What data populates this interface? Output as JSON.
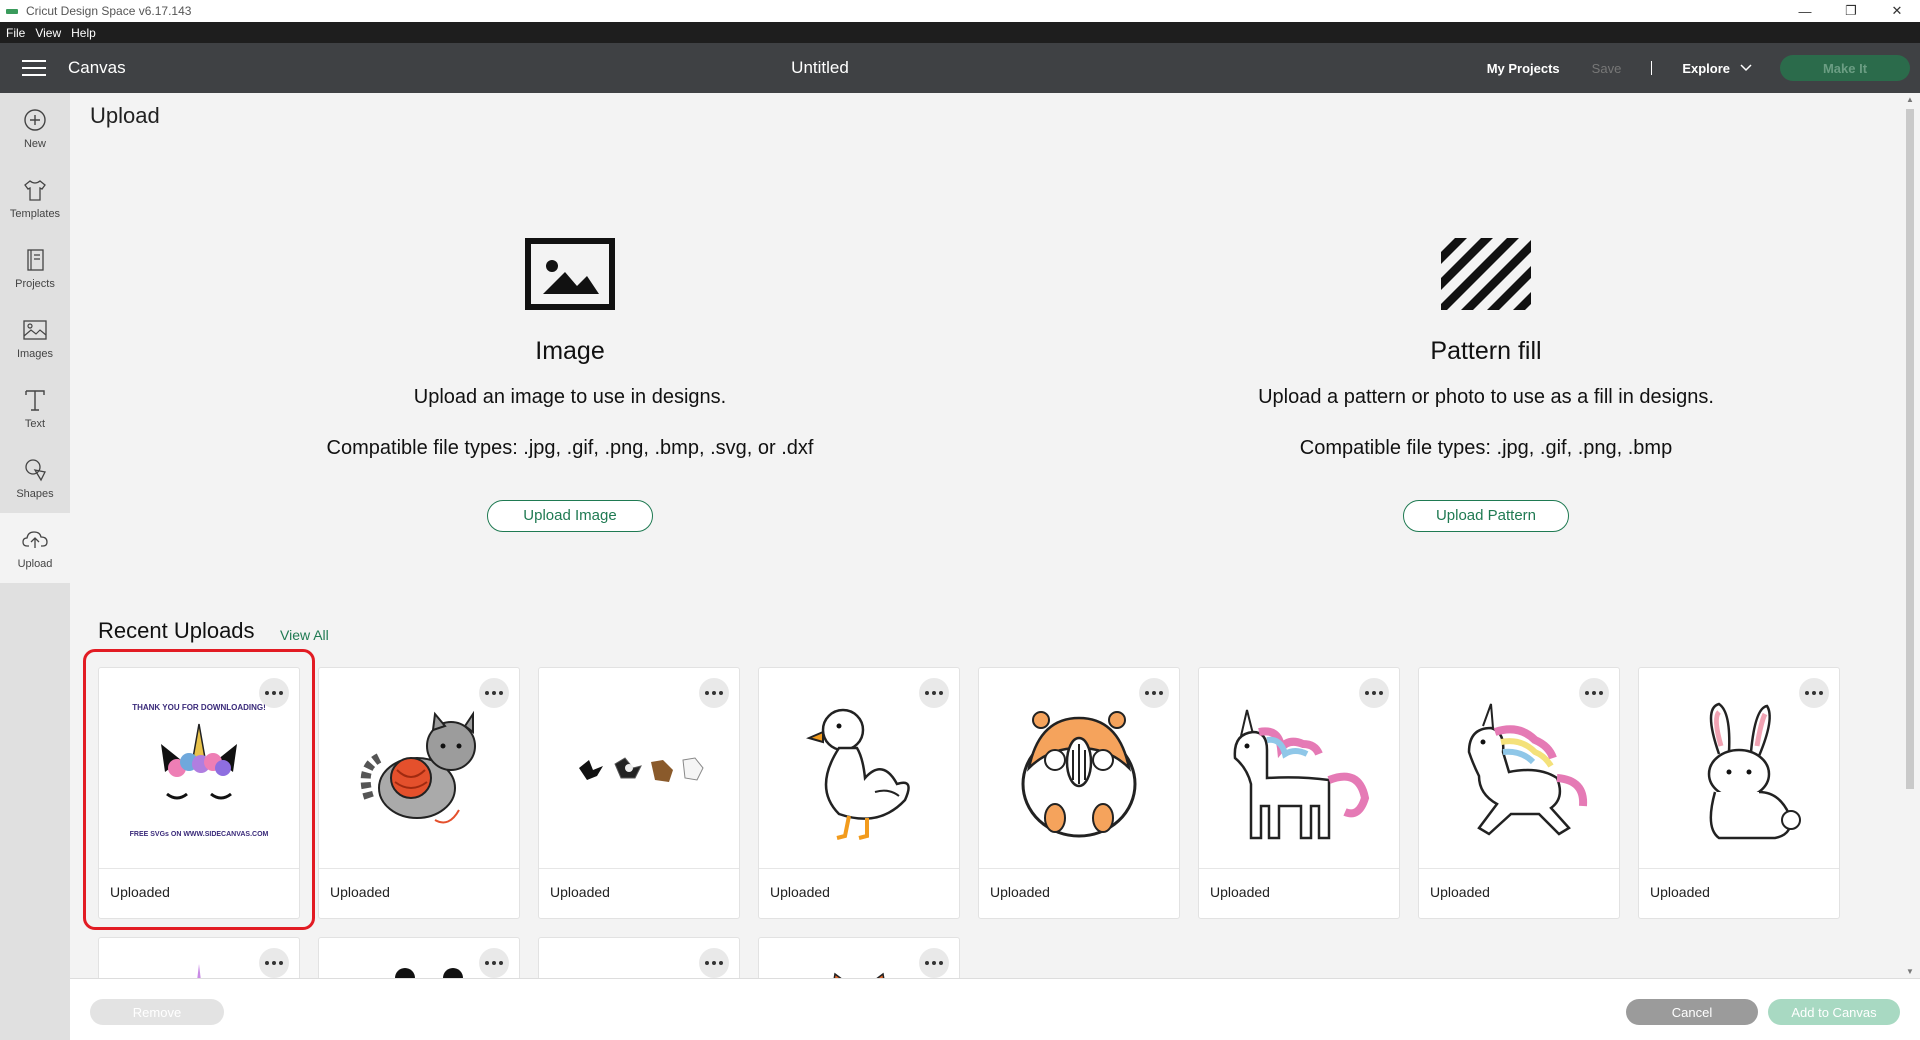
{
  "window": {
    "app_title": "Cricut Design Space  v6.17.143",
    "controls": [
      "—",
      "❐",
      "✕"
    ]
  },
  "menu": [
    "File",
    "View",
    "Help"
  ],
  "topnav": {
    "section": "Canvas",
    "doc_title": "Untitled",
    "my_projects": "My Projects",
    "save": "Save",
    "explore": "Explore",
    "make_it": "Make It"
  },
  "sidebar": {
    "items": [
      {
        "label": "New",
        "icon": "plus-circle-icon"
      },
      {
        "label": "Templates",
        "icon": "shirt-icon"
      },
      {
        "label": "Projects",
        "icon": "book-icon"
      },
      {
        "label": "Images",
        "icon": "picture-icon"
      },
      {
        "label": "Text",
        "icon": "text-t-icon"
      },
      {
        "label": "Shapes",
        "icon": "shapes-icon"
      },
      {
        "label": "Upload",
        "icon": "cloud-upload-icon"
      }
    ]
  },
  "page": {
    "title": "Upload",
    "image_panel": {
      "title": "Image",
      "desc": "Upload an image to use in designs.",
      "types": "Compatible file types: .jpg, .gif, .png, .bmp, .svg, or .dxf",
      "button": "Upload Image"
    },
    "pattern_panel": {
      "title": "Pattern fill",
      "desc": "Upload a pattern or photo to use as a fill in designs.",
      "types": "Compatible file types: .jpg, .gif, .png, .bmp",
      "button": "Upload Pattern"
    },
    "recent_title": "Recent Uploads",
    "view_all": "View All",
    "uploads": [
      {
        "label": "Uploaded",
        "thumb": "unicorn-face",
        "top_text": "THANK YOU FOR DOWNLOADING!",
        "bottom_text": "FREE SVGs ON WWW.SIDECANVAS.COM"
      },
      {
        "label": "Uploaded",
        "thumb": "cat-with-yarn"
      },
      {
        "label": "Uploaded",
        "thumb": "small-figures"
      },
      {
        "label": "Uploaded",
        "thumb": "duck"
      },
      {
        "label": "Uploaded",
        "thumb": "hamster"
      },
      {
        "label": "Uploaded",
        "thumb": "unicorn-standing"
      },
      {
        "label": "Uploaded",
        "thumb": "unicorn-running"
      },
      {
        "label": "Uploaded",
        "thumb": "bunny"
      }
    ]
  },
  "footer": {
    "remove": "Remove",
    "cancel": "Cancel",
    "add_to_canvas": "Add to Canvas"
  },
  "colors": {
    "accent": "#1f7a52",
    "topnav": "#3f4144",
    "highlight": "#e21b23"
  }
}
